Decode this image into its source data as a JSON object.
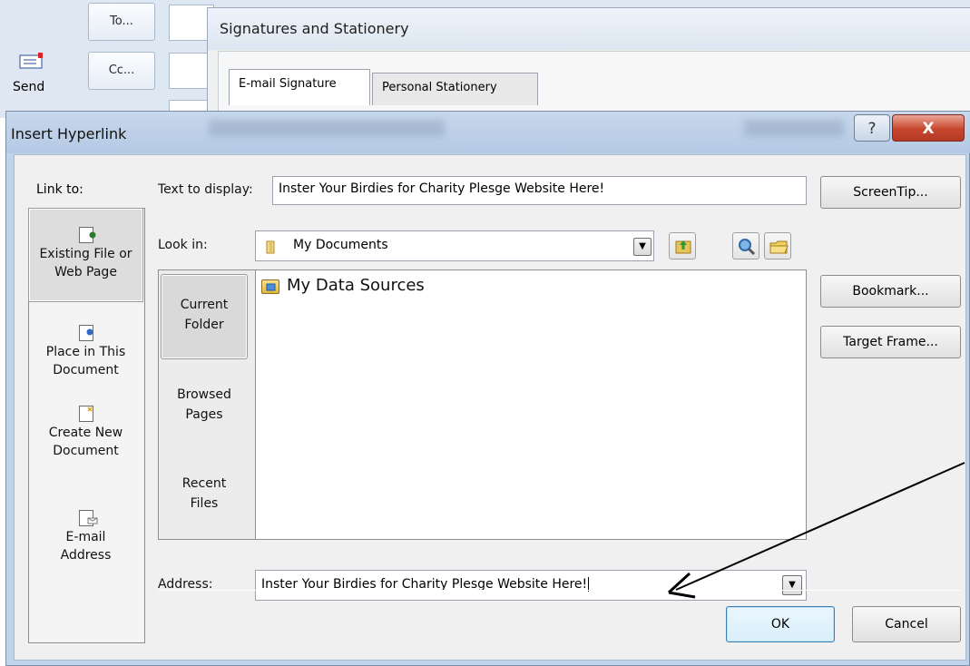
{
  "message_window": {
    "send_label": "Send",
    "to_button": "To...",
    "cc_button": "Cc..."
  },
  "signatures_dialog": {
    "title": "Signatures and Stationery",
    "tabs": [
      {
        "label": "E-mail Signature",
        "active": true
      },
      {
        "label": "Personal Stationery",
        "active": false
      }
    ]
  },
  "hyperlink_dialog": {
    "title": "Insert Hyperlink",
    "help_glyph": "?",
    "close_glyph": "X",
    "link_to": {
      "label": "Link to:",
      "items": [
        {
          "line1": "Existing File or",
          "line2": "Web Page",
          "icon": "web-page-icon",
          "selected": true
        },
        {
          "line1": "Place in This",
          "line2": "Document",
          "icon": "document-place-icon",
          "selected": false
        },
        {
          "line1": "Create New",
          "line2": "Document",
          "icon": "new-document-icon",
          "selected": false
        },
        {
          "line1": "E-mail",
          "line2": "Address",
          "icon": "email-icon",
          "selected": false
        }
      ]
    },
    "text_to_display": {
      "label": "Text to display:",
      "value": "Inster Your Birdies for Charity Plesge Website Here!"
    },
    "screentip_button": "ScreenTip...",
    "look_in": {
      "label": "Look in:",
      "value": "My Documents",
      "icon": "folder-icon"
    },
    "browse_tabs": [
      {
        "line1": "Current",
        "line2": "Folder",
        "selected": true
      },
      {
        "line1": "Browsed",
        "line2": "Pages",
        "selected": false
      },
      {
        "line1": "Recent",
        "line2": "Files",
        "selected": false
      }
    ],
    "files": [
      {
        "name": "My Data Sources",
        "icon": "data-sources-folder-icon"
      }
    ],
    "side_buttons": {
      "bookmark": "Bookmark...",
      "target_frame": "Target Frame..."
    },
    "address": {
      "label": "Address:",
      "value": "Inster Your Birdies for Charity Plesge Website Here!"
    },
    "ok_button": "OK",
    "cancel_button": "Cancel"
  },
  "colors": {
    "dialog_frame": "#bfd3ea",
    "close_button": "#c9462d",
    "client_background": "#f0f0f0"
  }
}
